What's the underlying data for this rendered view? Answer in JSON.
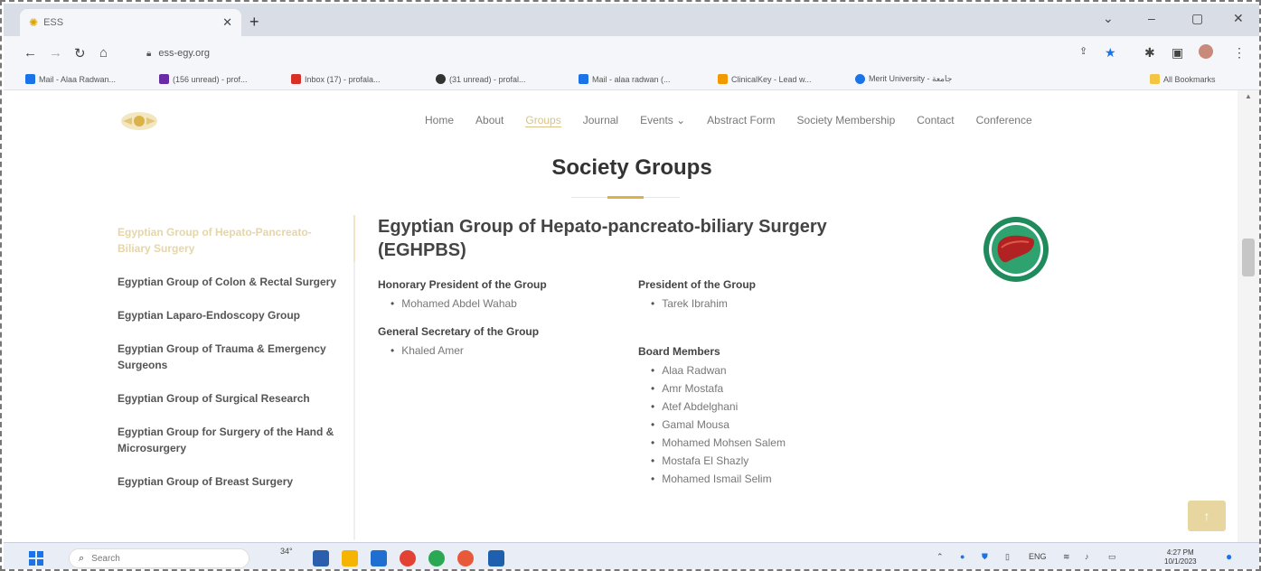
{
  "browser": {
    "tab_title": "ESS",
    "new_tab": "+",
    "url": "ess-egy.org",
    "window_controls": [
      "⌄",
      "–",
      "▢",
      "✕"
    ]
  },
  "bookmarks": [
    {
      "label": "Mail - Alaa Radwan...",
      "color": "#1a73e8"
    },
    {
      "label": "(156 unread) - prof...",
      "color": "#6a2ca6"
    },
    {
      "label": "Inbox (17) - profala...",
      "color": "#d93025"
    },
    {
      "label": "(31 unread) - profal...",
      "color": "#333333"
    },
    {
      "label": "Mail - alaa radwan (...",
      "color": "#1a73e8"
    },
    {
      "label": "ClinicalKey - Lead w...",
      "color": "#f29900"
    },
    {
      "label": "Merit University - جامعة",
      "color": "#1a73e8"
    }
  ],
  "all_bookmarks": "All Bookmarks",
  "site": {
    "nav": [
      "Home",
      "About",
      "Groups",
      "Journal",
      "Events ⌄",
      "Abstract Form",
      "Society Membership",
      "Contact",
      "Conference"
    ],
    "page_title": "Society Groups",
    "sidebar": [
      "Egyptian Group of Hepato-Pancreato-Biliary Surgery",
      "Egyptian Group of Colon & Rectal Surgery",
      "Egyptian Laparo-Endoscopy Group",
      "Egyptian Group of Trauma & Emergency Surgeons",
      "Egyptian Group of Surgical Research",
      "Egyptian Group for Surgery of the Hand & Microsurgery",
      "Egyptian Group of Breast Surgery"
    ],
    "group": {
      "title": "Egyptian Group of Hepato-pancreato-biliary Surgery (EGHPBS)",
      "honorary_president_heading": "Honorary President of the Group",
      "honorary_president": [
        "Mohamed Abdel Wahab"
      ],
      "general_secretary_heading": "General Secretary of the Group",
      "general_secretary": [
        "Khaled Amer"
      ],
      "president_heading": "President of the Group",
      "president": [
        "Tarek Ibrahim"
      ],
      "board_heading": "Board Members",
      "board": [
        "Alaa Radwan",
        "Amr Mostafa",
        "Atef Abdelghani",
        "Gamal Mousa",
        "Mohamed Mohsen Salem",
        "Mostafa El Shazly",
        "Mohamed Ismail Selim"
      ]
    },
    "back_to_top": "↑"
  },
  "taskbar": {
    "search_placeholder": "Search",
    "weather": "34°",
    "language": "ENG",
    "time": "4:27 PM",
    "date": "10/1/2023"
  },
  "colors": {
    "accent_gold": "#d9b24a",
    "active_nav": "#d6c28a",
    "badge_green": "#1f8a5b",
    "liver_red": "#b22222"
  }
}
